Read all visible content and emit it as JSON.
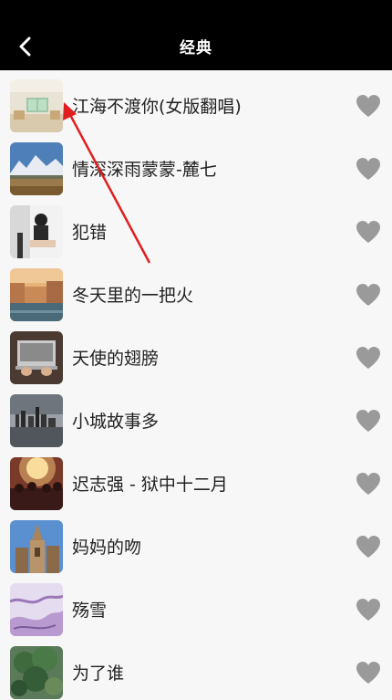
{
  "header": {
    "title": "经典"
  },
  "songs": [
    {
      "title": "江海不渡你(女版翻唱)",
      "thumb": "room"
    },
    {
      "title": "情深深雨蒙蒙-麓七",
      "thumb": "mountains"
    },
    {
      "title": "犯错",
      "thumb": "girl"
    },
    {
      "title": "冬天里的一把火",
      "thumb": "venice"
    },
    {
      "title": "天使的翅膀",
      "thumb": "laptop"
    },
    {
      "title": "小城故事多",
      "thumb": "city"
    },
    {
      "title": "迟志强 - 狱中十二月",
      "thumb": "concert"
    },
    {
      "title": "妈妈的吻",
      "thumb": "cathedral"
    },
    {
      "title": "殇雪",
      "thumb": "marble"
    },
    {
      "title": "为了谁",
      "thumb": "tree"
    }
  ],
  "colors": {
    "header_bg": "#000000",
    "list_bg": "#f7f7f7",
    "heart": "#9a9a9a",
    "annotation_arrow": "#e01e1e"
  }
}
